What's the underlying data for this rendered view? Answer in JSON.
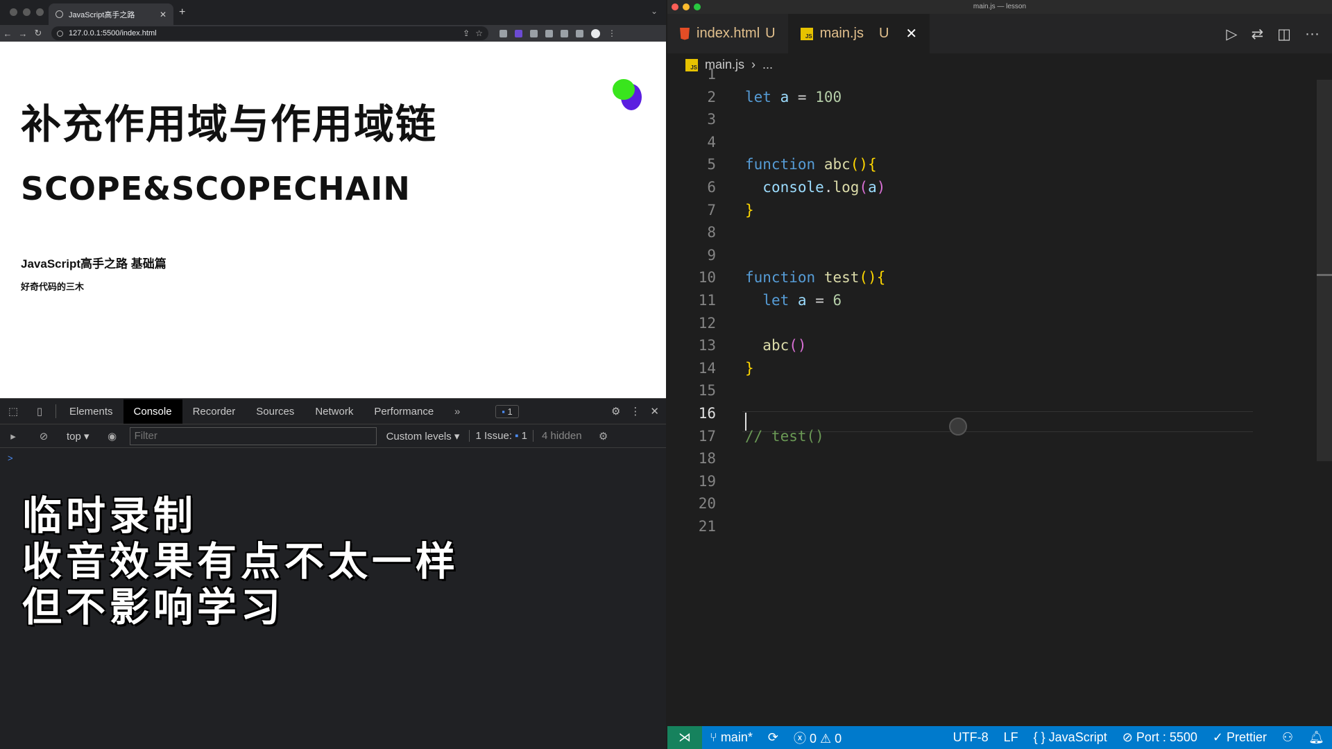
{
  "browser": {
    "tab_title": "JavaScript高手之路",
    "url": "127.0.0.1:5500/index.html",
    "page": {
      "heading": "补充作用域与作用域链",
      "subheading": "SCOPE&SCOPECHAIN",
      "course": "JavaScript高手之路 基础篇",
      "author": "好奇代码的三木"
    },
    "devtools": {
      "tabs": [
        "Elements",
        "Console",
        "Recorder",
        "Sources",
        "Network",
        "Performance"
      ],
      "active_tab": "Console",
      "messages_badge": "1",
      "context": "top",
      "filter_placeholder": "Filter",
      "levels": "Custom levels",
      "issues": "1 Issue:",
      "issues_count": "1",
      "hidden": "4 hidden",
      "prompt": ">"
    },
    "overlay_lines": [
      "临时录制",
      "收音效果有点不太一样",
      "但不影响学习"
    ]
  },
  "editor": {
    "window_title": "main.js — lesson",
    "tabs": [
      {
        "name": "index.html",
        "status": "U"
      },
      {
        "name": "main.js",
        "status": "U"
      }
    ],
    "breadcrumb": [
      "main.js",
      "..."
    ],
    "current_line": 16,
    "lines": [
      "",
      "let a = 100",
      "",
      "",
      "function abc(){",
      "  console.log(a)",
      "}",
      "",
      "",
      "function test(){",
      "  let a = 6",
      "",
      "  abc()",
      "}",
      "",
      "",
      "// test()",
      "",
      "",
      "",
      ""
    ]
  },
  "statusbar": {
    "branch": "main*",
    "errors": "0",
    "warnings": "0",
    "encoding": "UTF-8",
    "eol": "LF",
    "language": "JavaScript",
    "port": "Port : 5500",
    "formatter": "Prettier"
  },
  "colors": {
    "statusbar": "#007acc",
    "keyword": "#569cd6",
    "function": "#dcdcaa",
    "number": "#b5cea8",
    "comment": "#6a9955"
  }
}
